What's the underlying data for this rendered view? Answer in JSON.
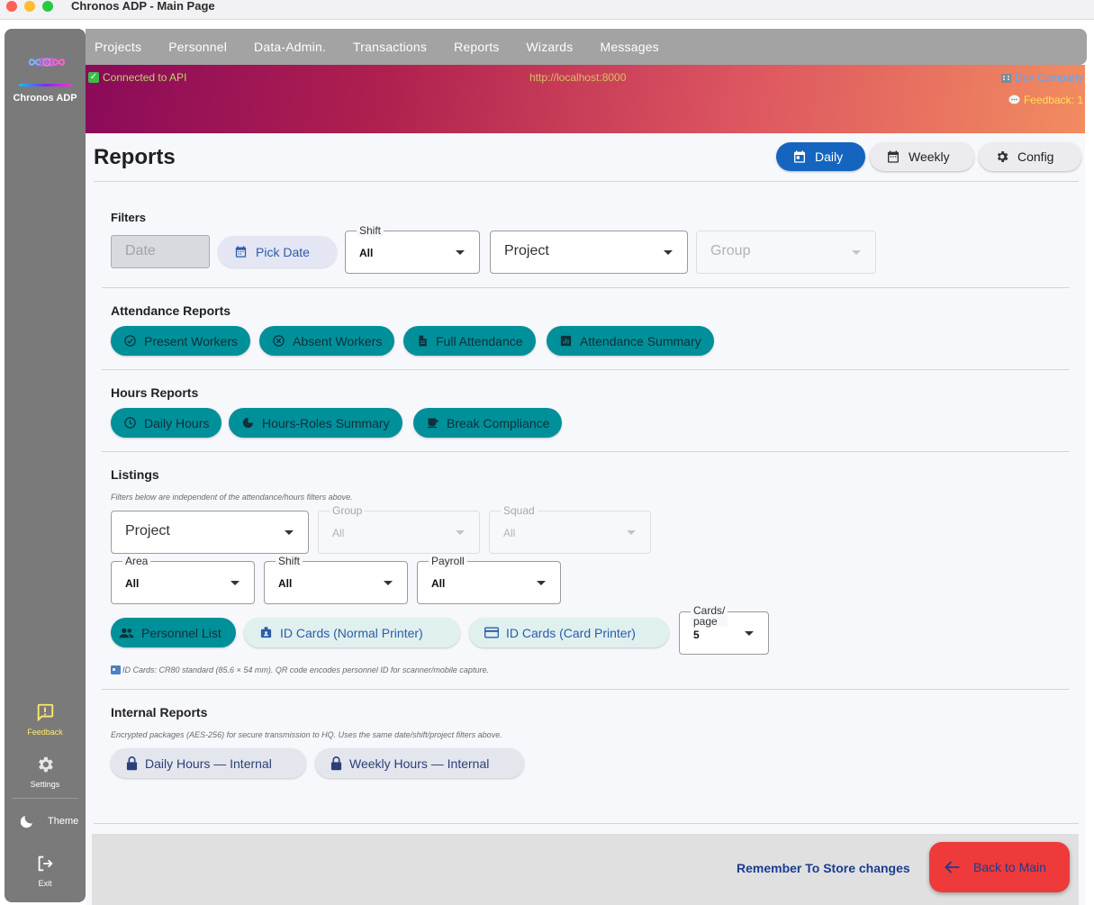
{
  "window": {
    "title": "Chronos ADP - Main Page"
  },
  "sidebar": {
    "brand": "Chronos ADP",
    "feedback": "Feedback",
    "settings": "Settings",
    "theme": "Theme",
    "exit": "Exit"
  },
  "menu": [
    "Projects",
    "Personnel",
    "Data-Admin.",
    "Transactions",
    "Reports",
    "Wizards",
    "Messages"
  ],
  "banner": {
    "status": "Connected to API",
    "url": "http://localhost:8000",
    "company": "Dev Company",
    "feedback": "Feedback: 1"
  },
  "header": {
    "title": "Reports",
    "daily": "Daily",
    "weekly": "Weekly",
    "config": "Config"
  },
  "filters": {
    "title": "Filters",
    "date_placeholder": "Date",
    "pick_date": "Pick Date",
    "shift_label": "Shift",
    "shift_value": "All",
    "project_placeholder": "Project",
    "group_placeholder": "Group"
  },
  "attendance": {
    "title": "Attendance Reports",
    "present": "Present Workers",
    "absent": "Absent Workers",
    "full": "Full Attendance",
    "summary": "Attendance Summary"
  },
  "hours": {
    "title": "Hours Reports",
    "daily": "Daily Hours",
    "roles": "Hours-Roles Summary",
    "break": "Break Compliance"
  },
  "listings": {
    "title": "Listings",
    "note": "Filters below are independent of the attendance/hours filters above.",
    "project_placeholder": "Project",
    "group_label": "Group",
    "group_value": "All",
    "squad_label": "Squad",
    "squad_value": "All",
    "area_label": "Area",
    "area_value": "All",
    "shift_label": "Shift",
    "shift_value": "All",
    "payroll_label": "Payroll",
    "payroll_value": "All",
    "personnel_list": "Personnel List",
    "id_normal": "ID Cards (Normal Printer)",
    "id_card": "ID Cards (Card Printer)",
    "cards_label_1": "Cards/",
    "cards_label_2": "page",
    "cards_value": "5",
    "id_note": "ID Cards: CR80 standard (85.6 × 54 mm). QR code encodes personnel ID for scanner/mobile capture."
  },
  "internal": {
    "title": "Internal Reports",
    "note": "Encrypted packages (AES-256) for secure transmission to HQ. Uses the same date/shift/project filters above.",
    "daily": "Daily Hours — Internal",
    "weekly": "Weekly Hours — Internal"
  },
  "footer": {
    "remember": "Remember To Store changes",
    "back": "Back to Main"
  },
  "colors": {
    "teal_chip": "#00909a",
    "primary": "#1565c0",
    "back_button": "#ee3a3a",
    "link_blue": "#1a3d8f"
  }
}
